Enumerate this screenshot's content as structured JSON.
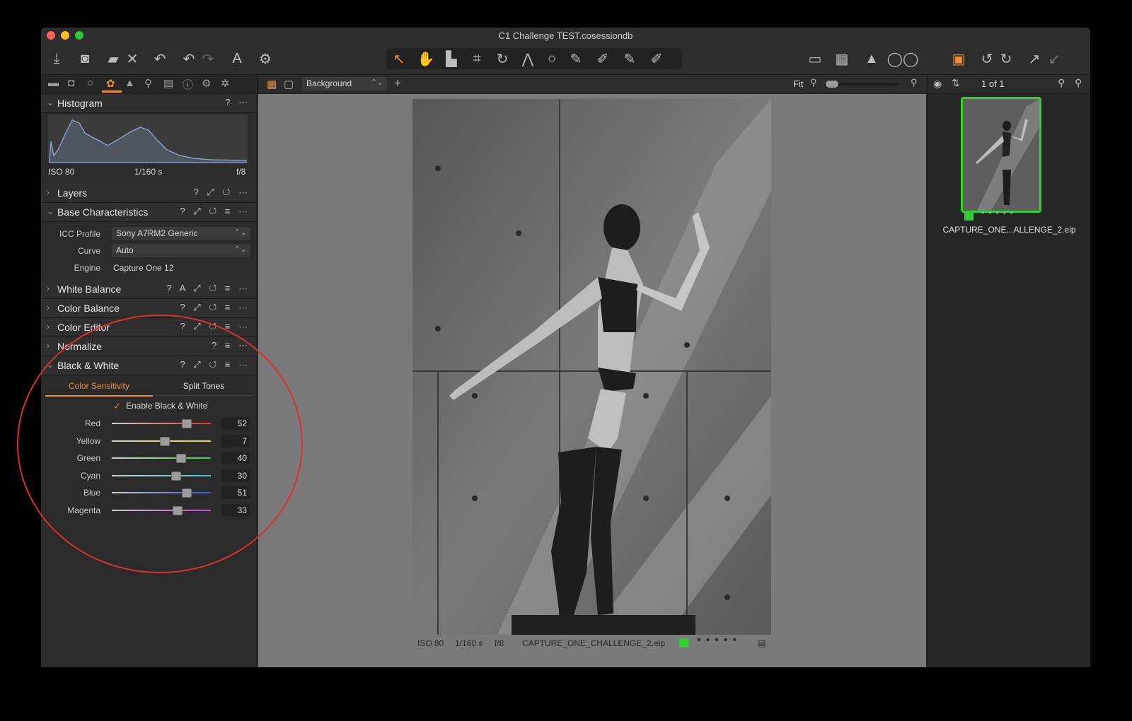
{
  "window": {
    "title": "C1 Challenge TEST.cosessiondb"
  },
  "colors": {
    "accent": "#f08c32",
    "green_label": "#2ed12e",
    "circle": "#d8312a"
  },
  "toolbar": {
    "left_icons": [
      "import-icon",
      "camera-icon",
      "open-folder-icon",
      "delete-icon",
      "undo-history-icon",
      "undo-icon",
      "redo-icon",
      "text-icon",
      "gear-icon"
    ],
    "cursor_tools": [
      "select-cursor-icon",
      "pan-icon",
      "loupe-icon",
      "crop-icon",
      "rotate-icon",
      "keystone-icon",
      "spot-icon",
      "brush-icon",
      "eraser-icon",
      "gradient-icon",
      "linear-gradient-icon"
    ],
    "right_icons": [
      "edit-icon",
      "grid-icon",
      "warning-icon",
      "proof-glasses-icon",
      "stack-icon",
      "rotate-left-icon",
      "rotate-right-icon",
      "copy-adjust-icon",
      "apply-adjust-icon"
    ]
  },
  "left": {
    "histogram": {
      "title": "Histogram",
      "iso": "ISO 80",
      "shutter": "1/160 s",
      "aperture": "f/8"
    },
    "layers": {
      "title": "Layers"
    },
    "base": {
      "title": "Base Characteristics",
      "icc_label": "ICC Profile",
      "icc_value": "Sony A7RM2 Generic",
      "curve_label": "Curve",
      "curve_value": "Auto",
      "engine_label": "Engine",
      "engine_value": "Capture One 12"
    },
    "white_balance": {
      "title": "White Balance"
    },
    "color_balance": {
      "title": "Color Balance"
    },
    "color_editor": {
      "title": "Color Editor"
    },
    "normalize": {
      "title": "Normalize"
    },
    "bw": {
      "title": "Black & White",
      "tab_active": "Color Sensitivity",
      "tab_other": "Split Tones",
      "enable_label": "Enable Black & White",
      "enable_checked": true,
      "sliders": [
        {
          "label": "Red",
          "value": "52",
          "color": "#e03434"
        },
        {
          "label": "Yellow",
          "value": "7",
          "color": "#e8d630"
        },
        {
          "label": "Green",
          "value": "40",
          "color": "#3ccb3c"
        },
        {
          "label": "Cyan",
          "value": "30",
          "color": "#39c8d6"
        },
        {
          "label": "Blue",
          "value": "51",
          "color": "#3a55e6"
        },
        {
          "label": "Magenta",
          "value": "33",
          "color": "#d23ad6"
        }
      ]
    }
  },
  "center": {
    "layer_select": "Background",
    "zoom_label": "Fit",
    "status": {
      "iso": "ISO 80",
      "shutter": "1/160 s",
      "aperture": "f/8",
      "filename": "CAPTURE_ONE_CHALLENGE_2.eip"
    }
  },
  "right": {
    "count": "1 of 1",
    "thumb_name": "CAPTURE_ONE...ALLENGE_2.eip"
  }
}
